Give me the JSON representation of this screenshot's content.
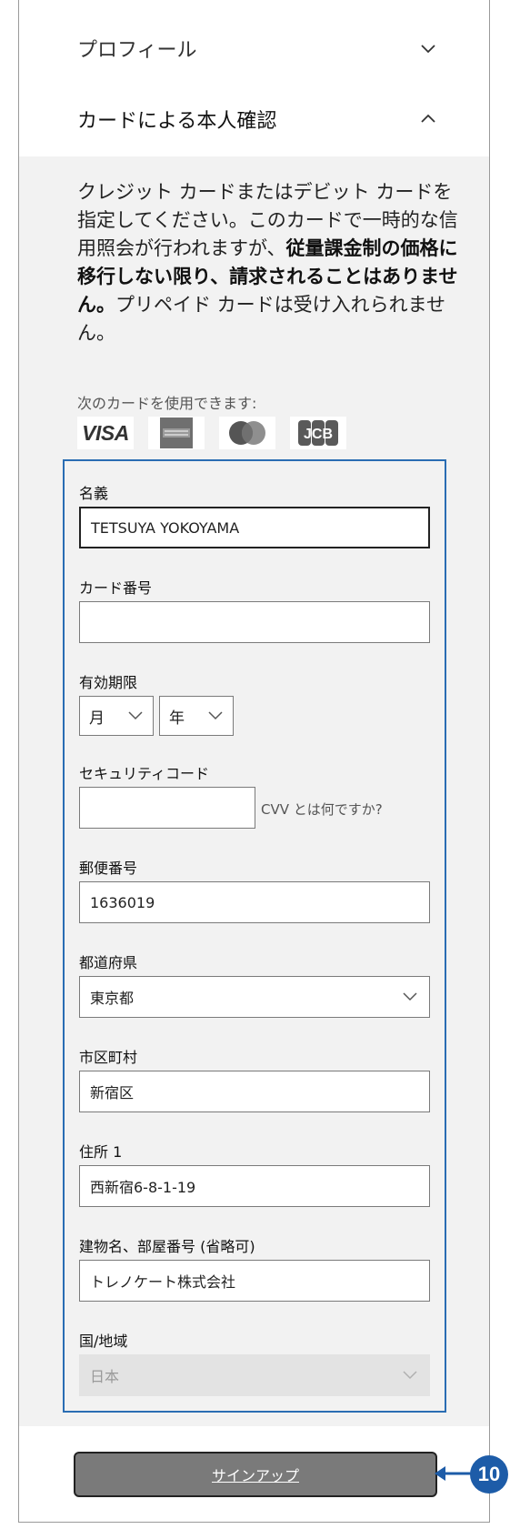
{
  "accordion": {
    "profile_label": "プロフィール",
    "card_verify_label": "カードによる本人確認"
  },
  "description": {
    "part1": "クレジット カードまたはデビット カードを指定してください。このカードで一時的な信用照会が行われますが、",
    "bold": "従量課金制の価格に移行しない限り、請求されることはありません。",
    "part2": "プリペイド カードは受け入れられません。"
  },
  "cards": {
    "label": "次のカードを使用できます:",
    "visa": "VISA",
    "jcb": "JCB",
    "icons": [
      "visa-icon",
      "amex-icon",
      "mastercard-icon",
      "jcb-icon"
    ]
  },
  "form": {
    "name": {
      "label": "名義",
      "value": "TETSUYA YOKOYAMA"
    },
    "card_number": {
      "label": "カード番号",
      "value": ""
    },
    "expiry": {
      "label": "有効期限",
      "month": "月",
      "year": "年"
    },
    "security": {
      "label": "セキュリティコード",
      "value": "",
      "hint": "CVV とは何ですか?"
    },
    "postal": {
      "label": "郵便番号",
      "value": "1636019"
    },
    "prefecture": {
      "label": "都道府県",
      "value": "東京都"
    },
    "city": {
      "label": "市区町村",
      "value": "新宿区"
    },
    "address1": {
      "label": "住所 1",
      "value": "西新宿6-8-1-19"
    },
    "building": {
      "label": "建物名、部屋番号 (省略可)",
      "value": "トレノケート株式会社"
    },
    "country": {
      "label": "国/地域",
      "value": "日本"
    }
  },
  "signup": {
    "label": "サインアップ"
  },
  "callout": {
    "number": "10"
  },
  "colors": {
    "focus_border": "#2a6db3",
    "callout": "#1d5ca8",
    "button": "#7a7a7a"
  }
}
